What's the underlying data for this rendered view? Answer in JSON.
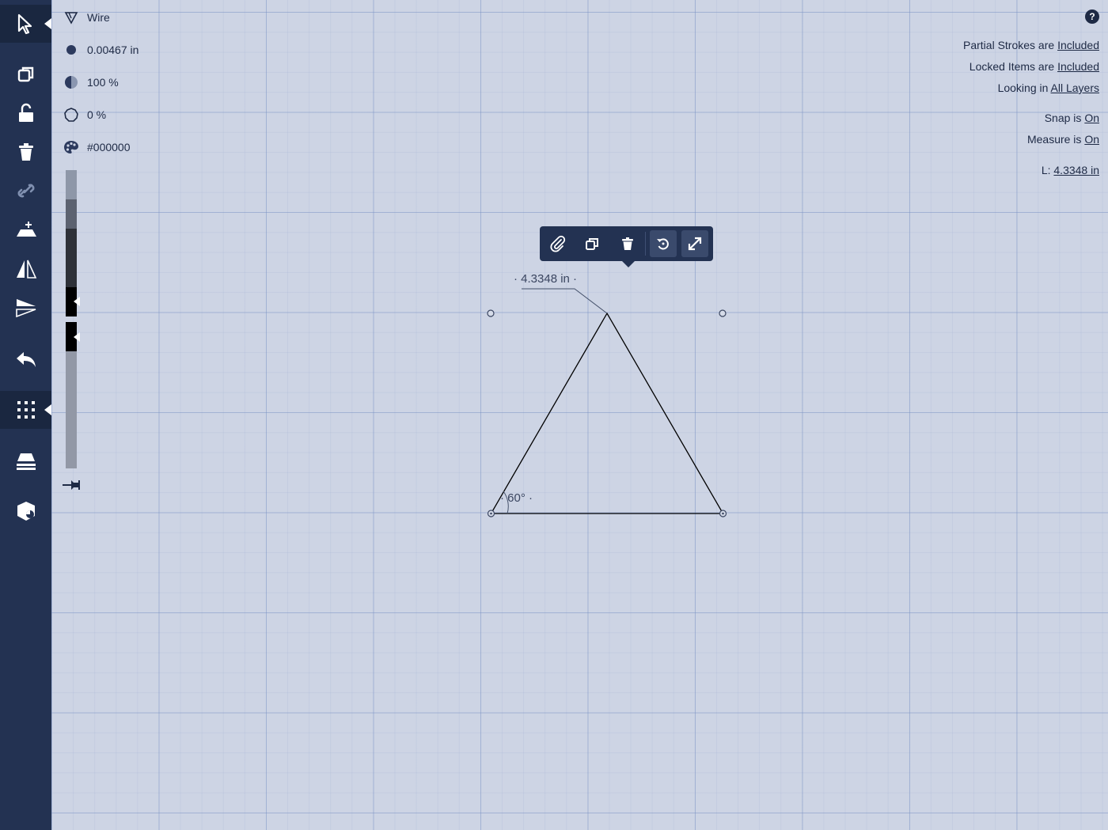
{
  "properties": {
    "brush_name": "Wire",
    "stroke_width": "0.00467 in",
    "opacity": "100 %",
    "smoothing": "0 %",
    "color": "#000000"
  },
  "status": {
    "partial_prefix": "Partial Strokes are ",
    "partial_value": "Included",
    "locked_prefix": "Locked Items are ",
    "locked_value": "Included",
    "looking_prefix": "Looking in ",
    "looking_value": "All Layers",
    "snap_prefix": "Snap is ",
    "snap_value": "On",
    "measure_prefix": "Measure is ",
    "measure_value": "On",
    "length_prefix": "L: ",
    "length_value": "4.3348 in"
  },
  "help_label": "?",
  "measurements": {
    "length_label": "· 4.3348 in ·",
    "angle_label": "· 60° ·"
  },
  "colors": {
    "sidebar": "#233252",
    "canvas": "#cdd4e4",
    "accent": "#1e2a45",
    "stroke": "#000000"
  },
  "sidebar_icons": [
    "select-icon",
    "duplicate-icon",
    "lock-icon",
    "trash-icon",
    "link-icon",
    "add-layer-icon",
    "flip-horizontal-icon",
    "flip-vertical-icon",
    "undo-icon",
    "grid-icon",
    "layers-icon",
    "shapes-icon"
  ]
}
